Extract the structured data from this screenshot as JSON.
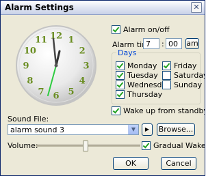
{
  "window": {
    "title": "Alarm Settings",
    "close_glyph": "✕"
  },
  "clock": {
    "numerals": [
      "12",
      "1",
      "2",
      "3",
      "4",
      "5",
      "6",
      "7",
      "8",
      "9",
      "10",
      "11"
    ]
  },
  "alarm": {
    "enable_label": "Alarm on/off",
    "enable_checked": true,
    "time_label": "Alarm time:",
    "hour": "7",
    "separator": ":",
    "minute": "00",
    "ampm": "am"
  },
  "days": {
    "group_label": "Days",
    "items": [
      {
        "label": "Monday",
        "checked": true
      },
      {
        "label": "Tuesday",
        "checked": true
      },
      {
        "label": "Wednesday",
        "checked": true
      },
      {
        "label": "Thursday",
        "checked": true
      },
      {
        "label": "Friday",
        "checked": true
      },
      {
        "label": "Saturday",
        "checked": false
      },
      {
        "label": "Sunday",
        "checked": false
      }
    ]
  },
  "standby": {
    "label": "Wake up from standby",
    "checked": true
  },
  "sound": {
    "label": "Sound File:",
    "selected": "alarm sound 3",
    "play_glyph": "▶",
    "browse_label": "Browse..."
  },
  "volume": {
    "label": "Volume:",
    "level_percent": 47
  },
  "gradual": {
    "label": "Gradual Wake",
    "checked": true
  },
  "buttons": {
    "ok": "OK",
    "cancel": "Cancel"
  },
  "colors": {
    "clock_numerals": "#6b8e23",
    "second_hand": "#2ecc40",
    "title_bar": "#c9d2e8"
  }
}
